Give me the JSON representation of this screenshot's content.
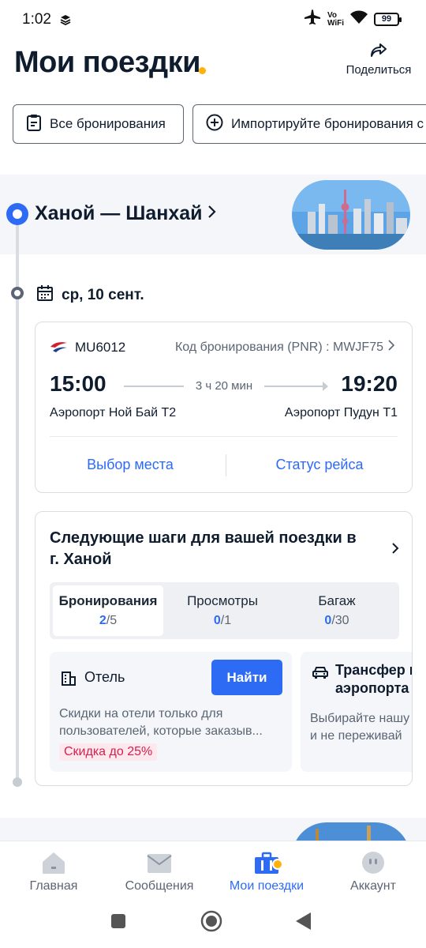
{
  "status_bar": {
    "time": "1:02",
    "network": "Vo WiFi",
    "battery": "99"
  },
  "header": {
    "title": "Мои поездки",
    "share_label": "Поделиться"
  },
  "chips": {
    "all_bookings": "Все бронирования",
    "import_bookings": "Импортируйте бронирования с"
  },
  "trip": {
    "route": "Ханой — Шанхай",
    "date": "ср, 10 сент."
  },
  "flight": {
    "number": "MU6012",
    "pnr": "Код бронирования (PNR) : MWJF75",
    "departure_time": "15:00",
    "arrival_time": "19:20",
    "duration": "3 ч 20 мин",
    "departure_airport": "Аэропорт Ной Бай T2",
    "arrival_airport": "Аэропорт Пудун T1",
    "seat_selection": "Выбор места",
    "flight_status": "Статус рейса"
  },
  "next_steps": {
    "title": "Следующие шаги для вашей поездки в г. Ханой",
    "tabs": [
      {
        "label": "Бронирования",
        "done": "2",
        "total": "/5"
      },
      {
        "label": "Просмотры",
        "done": "0",
        "total": "/1"
      },
      {
        "label": "Багаж",
        "done": "0",
        "total": "/30"
      }
    ],
    "hotel": {
      "label": "Отель",
      "button": "Найти",
      "description": "Скидки на отели только для пользователей, которые заказыв...",
      "discount": "Скидка до 25%"
    },
    "transfer": {
      "label_line1": "Трансфер и",
      "label_line2": "аэропорта",
      "desc_line1": "Выбирайте нашу",
      "desc_line2": "и не переживай"
    }
  },
  "bottom_nav": {
    "items": [
      {
        "label": "Главная",
        "icon": "home-icon"
      },
      {
        "label": "Сообщения",
        "icon": "mail-icon"
      },
      {
        "label": "Мои поездки",
        "icon": "suitcase-icon"
      },
      {
        "label": "Аккаунт",
        "icon": "account-icon"
      }
    ],
    "active_index": 2
  },
  "colors": {
    "primary": "#2d6bf5",
    "accent_dot": "#ffb20d",
    "discount_text": "#d6204f",
    "text_dark": "#0f1c2e"
  }
}
